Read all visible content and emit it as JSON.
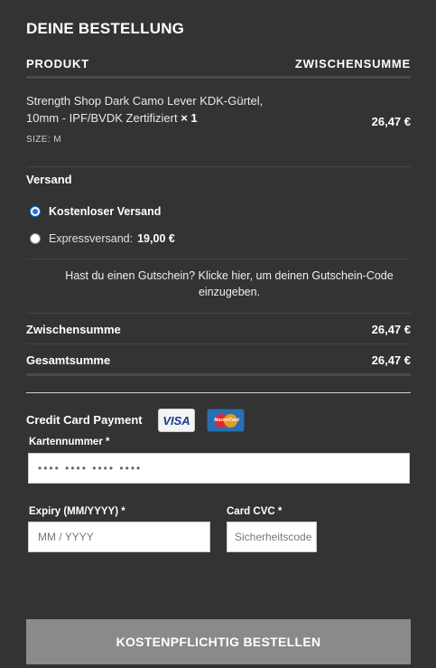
{
  "heading": "DEINE BESTELLUNG",
  "table": {
    "col_product": "PRODUKT",
    "col_subtotal": "ZWISCHENSUMME"
  },
  "product": {
    "name": "Strength Shop Dark Camo Lever KDK-Gürtel, 10mm - IPF/BVDK Zertifiziert",
    "quantity": "× 1",
    "size_label": "SIZE:",
    "size_value": "M",
    "price": "26,47 €"
  },
  "shipping": {
    "title": "Versand",
    "options": [
      {
        "label": "Kostenloser Versand",
        "price": "",
        "selected": true
      },
      {
        "label": "Expressversand:",
        "price": "19,00 €",
        "selected": false
      }
    ]
  },
  "coupon_text": "Hast du einen Gutschein? Klicke hier, um deinen Gutschein-Code einzugeben.",
  "totals": {
    "subtotal_label": "Zwischensumme",
    "subtotal_value": "26,47 €",
    "total_label": "Gesamtsumme",
    "total_value": "26,47 €"
  },
  "payment": {
    "title": "Credit Card Payment",
    "card_visa": "VISA",
    "card_mastercard": "MasterCard",
    "card_number_label": "Kartennummer *",
    "card_number_placeholder": "•••• •••• •••• ••••",
    "expiry_label": "Expiry (MM/YYYY) *",
    "expiry_placeholder": "MM / YYYY",
    "cvc_label": "Card CVC *",
    "cvc_placeholder": "Sicherheitscode"
  },
  "submit_label": "KOSTENPFLICHTIG BESTELLEN",
  "colors": {
    "background": "#333333",
    "button": "#8a8a8a",
    "radio_accent": "#1a73e8"
  }
}
